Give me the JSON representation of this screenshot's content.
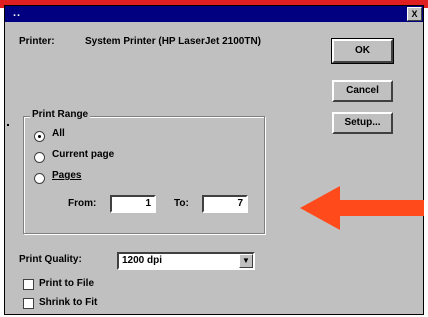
{
  "titlebar": {
    "title": "..",
    "close_label": "X"
  },
  "printer": {
    "label": "Printer:",
    "value": "System Printer (HP LaserJet 2100TN)"
  },
  "buttons": {
    "ok": "OK",
    "cancel": "Cancel",
    "setup": "Setup..."
  },
  "print_range": {
    "legend": "Print Range",
    "options": [
      {
        "label": "All",
        "selected": true
      },
      {
        "label": "Current page",
        "selected": false
      },
      {
        "label": "Pages",
        "selected": false
      }
    ],
    "from_label": "From:",
    "from_value": "1",
    "to_label": "To:",
    "to_value": "7"
  },
  "print_quality": {
    "label": "Print Quality:",
    "value": "1200 dpi"
  },
  "checkboxes": [
    {
      "label": "Print to File",
      "checked": false
    },
    {
      "label": "Shrink to Fit",
      "checked": false
    }
  ],
  "colors": {
    "arrow": "#ff4a1c",
    "titlebar": "#000080",
    "top_strip": "#e02020"
  },
  "icons": {
    "arrow": "arrow-left-icon",
    "dropdown": "chevron-down-icon"
  }
}
